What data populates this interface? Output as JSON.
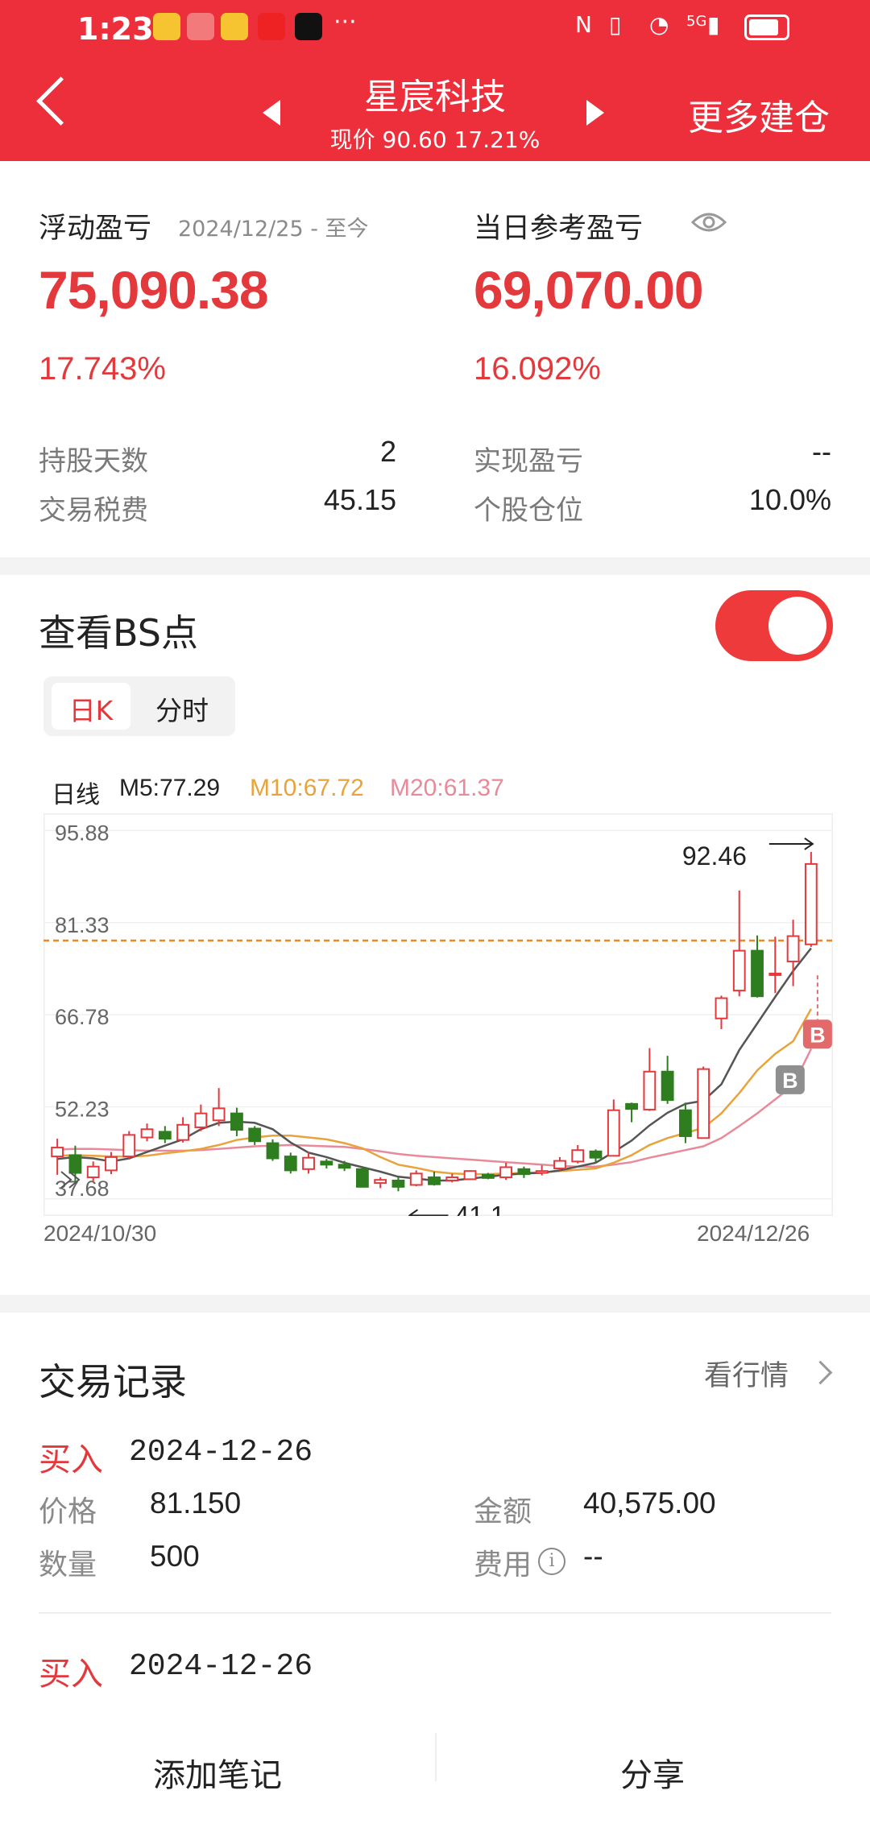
{
  "status_bar": {
    "time": "1:23",
    "more": "···",
    "network": "5G"
  },
  "header": {
    "title": "星宸科技",
    "subtitle": "现价 90.60 17.21%",
    "more_action": "更多建仓"
  },
  "summary": {
    "floating": {
      "label": "浮动盈亏",
      "range": "2024/12/25 - 至今",
      "value": "75,090.38",
      "percent": "17.743%"
    },
    "daily": {
      "label": "当日参考盈亏",
      "value": "69,070.00",
      "percent": "16.092%"
    },
    "stats": [
      {
        "label": "持股天数",
        "value": "2"
      },
      {
        "label": "实现盈亏",
        "value": "--"
      },
      {
        "label": "交易税费",
        "value": "45.15"
      },
      {
        "label": "个股仓位",
        "value": "10.0%"
      }
    ]
  },
  "bs": {
    "title": "查看BS点",
    "toggle_on": true,
    "tabs": [
      "日K",
      "分时"
    ],
    "active_tab": "日K",
    "ma": {
      "prefix": "日线",
      "m5": "M5:77.29",
      "m10": "M10:67.72",
      "m20": "M20:61.37"
    },
    "date_start": "2024/10/30",
    "date_end": "2024/12/26"
  },
  "chart_data": {
    "type": "candlestick",
    "y_ticks": [
      "95.88",
      "81.33",
      "66.78",
      "52.23",
      "37.68"
    ],
    "ylim": [
      35.0,
      98.6
    ],
    "grid": true,
    "ref_line": 78.5,
    "annotations": {
      "high_label": "92.46",
      "low_label": "41 1"
    },
    "markers": [
      {
        "label": "B",
        "color": "#e26a6a"
      },
      {
        "label": "B",
        "color": "#8f8f8f"
      }
    ],
    "colors": {
      "up": "#e4393c",
      "down": "#2e7d1f",
      "m5": "#555555",
      "m10": "#e8a33c",
      "m20": "#e88a9a"
    },
    "candles": [
      [
        44.4,
        45.8,
        41.5,
        47.2
      ],
      [
        44.6,
        41.8,
        40.5,
        46.1
      ],
      [
        41.1,
        42.8,
        40.3,
        43.6
      ],
      [
        42.2,
        44.3,
        41.6,
        45.1
      ],
      [
        44.4,
        47.8,
        43.9,
        48.4
      ],
      [
        47.4,
        48.7,
        46.8,
        49.6
      ],
      [
        48.3,
        47.2,
        46.5,
        49.2
      ],
      [
        47.0,
        49.4,
        46.6,
        50.6
      ],
      [
        49.0,
        51.2,
        48.4,
        52.6
      ],
      [
        50.1,
        52.0,
        49.2,
        55.2
      ],
      [
        51.2,
        48.6,
        47.6,
        52.1
      ],
      [
        48.8,
        46.8,
        46.2,
        49.2
      ],
      [
        46.5,
        44.1,
        43.7,
        47.1
      ],
      [
        44.4,
        42.2,
        41.7,
        45.0
      ],
      [
        42.4,
        44.2,
        41.7,
        45.1
      ],
      [
        43.6,
        43.1,
        42.5,
        44.0
      ],
      [
        43.1,
        42.6,
        42.1,
        43.7
      ],
      [
        42.4,
        39.6,
        39.5,
        42.8
      ],
      [
        40.2,
        40.7,
        39.4,
        41.1
      ],
      [
        40.6,
        39.6,
        38.9,
        41.1
      ],
      [
        39.9,
        41.7,
        39.7,
        42.2
      ],
      [
        41.1,
        40.0,
        39.8,
        42.0
      ],
      [
        40.6,
        41.1,
        40.3,
        41.7
      ],
      [
        40.8,
        42.1,
        40.7,
        42.2
      ],
      [
        41.5,
        41.0,
        40.8,
        41.8
      ],
      [
        41.1,
        42.7,
        40.7,
        43.4
      ],
      [
        42.4,
        41.6,
        41.0,
        42.8
      ],
      [
        41.8,
        42.1,
        41.4,
        43.0
      ],
      [
        42.5,
        43.7,
        42.2,
        44.3
      ],
      [
        43.6,
        45.4,
        43.3,
        46.2
      ],
      [
        45.2,
        44.2,
        43.5,
        45.5
      ],
      [
        44.5,
        51.7,
        44.5,
        53.4
      ],
      [
        52.7,
        51.9,
        49.8,
        52.9
      ],
      [
        51.8,
        57.8,
        51.6,
        61.5
      ],
      [
        57.8,
        53.3,
        52.7,
        60.3
      ],
      [
        51.7,
        47.6,
        46.5,
        52.9
      ],
      [
        47.3,
        58.2,
        47.3,
        58.6
      ],
      [
        66.2,
        69.4,
        64.5,
        69.8
      ],
      [
        70.6,
        76.9,
        69.7,
        86.4
      ],
      [
        76.9,
        69.7,
        69.5,
        79.3
      ],
      [
        73.1,
        73.3,
        70.2,
        79.1
      ],
      [
        75.2,
        79.2,
        71.3,
        81.8
      ],
      [
        77.9,
        90.6,
        77.5,
        92.5
      ]
    ],
    "m5": [
      44.0,
      44.3,
      44.1,
      43.6,
      44.1,
      45.1,
      46.1,
      47.1,
      48.7,
      49.7,
      49.9,
      49.7,
      48.7,
      46.6,
      45.0,
      44.3,
      43.4,
      42.7,
      42.0,
      41.2,
      40.9,
      40.6,
      40.6,
      40.9,
      41.2,
      41.5,
      41.7,
      41.8,
      42.2,
      42.8,
      43.4,
      45.1,
      46.9,
      49.3,
      51.3,
      52.7,
      53.2,
      55.8,
      61.2,
      65.4,
      69.6,
      73.7,
      77.3
    ],
    "m10": [
      44.5,
      44.6,
      44.5,
      44.4,
      44.4,
      44.5,
      44.9,
      45.2,
      45.6,
      46.2,
      47.0,
      47.4,
      47.7,
      47.7,
      47.4,
      47.1,
      46.5,
      45.7,
      44.3,
      43.1,
      42.6,
      42.0,
      41.7,
      41.6,
      41.6,
      41.7,
      41.8,
      41.9,
      42.1,
      42.3,
      42.5,
      43.4,
      44.6,
      46.2,
      47.3,
      48.1,
      48.9,
      51.2,
      54.4,
      58.0,
      60.6,
      62.6,
      67.7
    ],
    "m20": [
      45.5,
      45.6,
      45.6,
      45.5,
      45.4,
      45.3,
      45.3,
      45.3,
      45.4,
      45.6,
      45.8,
      46.0,
      46.1,
      46.2,
      46.1,
      46.0,
      45.9,
      45.6,
      45.2,
      44.8,
      44.5,
      44.3,
      44.1,
      43.9,
      43.7,
      43.5,
      43.3,
      43.1,
      42.9,
      42.8,
      42.8,
      43.1,
      43.5,
      44.2,
      44.8,
      45.4,
      46.0,
      47.3,
      49.2,
      51.2,
      53.4,
      55.6,
      61.4
    ]
  },
  "records": {
    "title": "交易记录",
    "link": "看行情",
    "entries": [
      {
        "type": "买入",
        "date": "2024-12-26",
        "price_label": "价格",
        "price": "81.150",
        "amount_label": "金额",
        "amount": "40,575.00",
        "qty_label": "数量",
        "qty": "500",
        "fee_label": "费用",
        "fee": "--"
      },
      {
        "type": "买入",
        "date": "2024-12-26"
      }
    ]
  },
  "bottom_bar": {
    "note": "添加笔记",
    "share": "分享"
  }
}
